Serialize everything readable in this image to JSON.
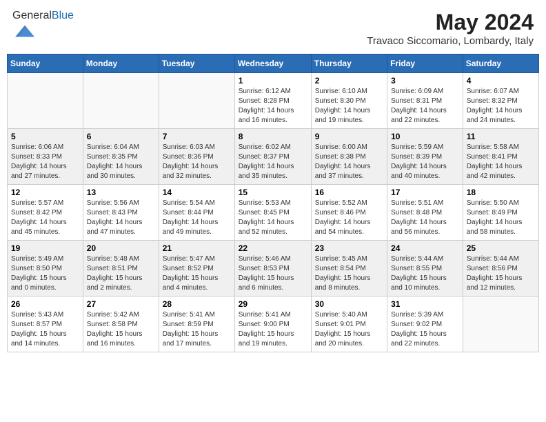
{
  "header": {
    "logo_general": "General",
    "logo_blue": "Blue",
    "month_year": "May 2024",
    "location": "Travaco Siccomario, Lombardy, Italy"
  },
  "weekdays": [
    "Sunday",
    "Monday",
    "Tuesday",
    "Wednesday",
    "Thursday",
    "Friday",
    "Saturday"
  ],
  "weeks": [
    [
      {
        "day": "",
        "info": ""
      },
      {
        "day": "",
        "info": ""
      },
      {
        "day": "",
        "info": ""
      },
      {
        "day": "1",
        "info": "Sunrise: 6:12 AM\nSunset: 8:28 PM\nDaylight: 14 hours and 16 minutes."
      },
      {
        "day": "2",
        "info": "Sunrise: 6:10 AM\nSunset: 8:30 PM\nDaylight: 14 hours and 19 minutes."
      },
      {
        "day": "3",
        "info": "Sunrise: 6:09 AM\nSunset: 8:31 PM\nDaylight: 14 hours and 22 minutes."
      },
      {
        "day": "4",
        "info": "Sunrise: 6:07 AM\nSunset: 8:32 PM\nDaylight: 14 hours and 24 minutes."
      }
    ],
    [
      {
        "day": "5",
        "info": "Sunrise: 6:06 AM\nSunset: 8:33 PM\nDaylight: 14 hours and 27 minutes."
      },
      {
        "day": "6",
        "info": "Sunrise: 6:04 AM\nSunset: 8:35 PM\nDaylight: 14 hours and 30 minutes."
      },
      {
        "day": "7",
        "info": "Sunrise: 6:03 AM\nSunset: 8:36 PM\nDaylight: 14 hours and 32 minutes."
      },
      {
        "day": "8",
        "info": "Sunrise: 6:02 AM\nSunset: 8:37 PM\nDaylight: 14 hours and 35 minutes."
      },
      {
        "day": "9",
        "info": "Sunrise: 6:00 AM\nSunset: 8:38 PM\nDaylight: 14 hours and 37 minutes."
      },
      {
        "day": "10",
        "info": "Sunrise: 5:59 AM\nSunset: 8:39 PM\nDaylight: 14 hours and 40 minutes."
      },
      {
        "day": "11",
        "info": "Sunrise: 5:58 AM\nSunset: 8:41 PM\nDaylight: 14 hours and 42 minutes."
      }
    ],
    [
      {
        "day": "12",
        "info": "Sunrise: 5:57 AM\nSunset: 8:42 PM\nDaylight: 14 hours and 45 minutes."
      },
      {
        "day": "13",
        "info": "Sunrise: 5:56 AM\nSunset: 8:43 PM\nDaylight: 14 hours and 47 minutes."
      },
      {
        "day": "14",
        "info": "Sunrise: 5:54 AM\nSunset: 8:44 PM\nDaylight: 14 hours and 49 minutes."
      },
      {
        "day": "15",
        "info": "Sunrise: 5:53 AM\nSunset: 8:45 PM\nDaylight: 14 hours and 52 minutes."
      },
      {
        "day": "16",
        "info": "Sunrise: 5:52 AM\nSunset: 8:46 PM\nDaylight: 14 hours and 54 minutes."
      },
      {
        "day": "17",
        "info": "Sunrise: 5:51 AM\nSunset: 8:48 PM\nDaylight: 14 hours and 56 minutes."
      },
      {
        "day": "18",
        "info": "Sunrise: 5:50 AM\nSunset: 8:49 PM\nDaylight: 14 hours and 58 minutes."
      }
    ],
    [
      {
        "day": "19",
        "info": "Sunrise: 5:49 AM\nSunset: 8:50 PM\nDaylight: 15 hours and 0 minutes."
      },
      {
        "day": "20",
        "info": "Sunrise: 5:48 AM\nSunset: 8:51 PM\nDaylight: 15 hours and 2 minutes."
      },
      {
        "day": "21",
        "info": "Sunrise: 5:47 AM\nSunset: 8:52 PM\nDaylight: 15 hours and 4 minutes."
      },
      {
        "day": "22",
        "info": "Sunrise: 5:46 AM\nSunset: 8:53 PM\nDaylight: 15 hours and 6 minutes."
      },
      {
        "day": "23",
        "info": "Sunrise: 5:45 AM\nSunset: 8:54 PM\nDaylight: 15 hours and 8 minutes."
      },
      {
        "day": "24",
        "info": "Sunrise: 5:44 AM\nSunset: 8:55 PM\nDaylight: 15 hours and 10 minutes."
      },
      {
        "day": "25",
        "info": "Sunrise: 5:44 AM\nSunset: 8:56 PM\nDaylight: 15 hours and 12 minutes."
      }
    ],
    [
      {
        "day": "26",
        "info": "Sunrise: 5:43 AM\nSunset: 8:57 PM\nDaylight: 15 hours and 14 minutes."
      },
      {
        "day": "27",
        "info": "Sunrise: 5:42 AM\nSunset: 8:58 PM\nDaylight: 15 hours and 16 minutes."
      },
      {
        "day": "28",
        "info": "Sunrise: 5:41 AM\nSunset: 8:59 PM\nDaylight: 15 hours and 17 minutes."
      },
      {
        "day": "29",
        "info": "Sunrise: 5:41 AM\nSunset: 9:00 PM\nDaylight: 15 hours and 19 minutes."
      },
      {
        "day": "30",
        "info": "Sunrise: 5:40 AM\nSunset: 9:01 PM\nDaylight: 15 hours and 20 minutes."
      },
      {
        "day": "31",
        "info": "Sunrise: 5:39 AM\nSunset: 9:02 PM\nDaylight: 15 hours and 22 minutes."
      },
      {
        "day": "",
        "info": ""
      }
    ]
  ]
}
